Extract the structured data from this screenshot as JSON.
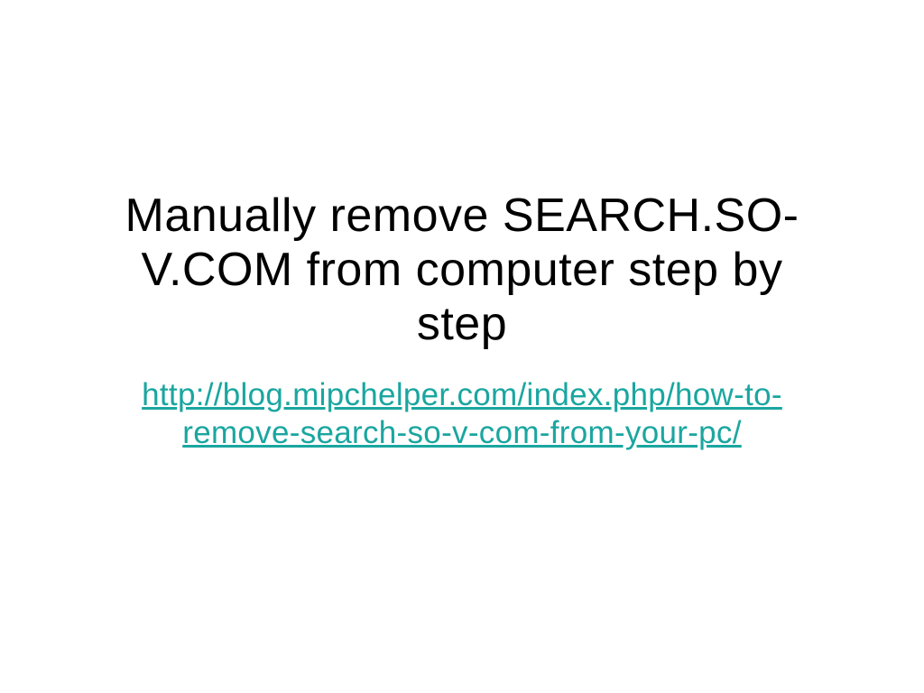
{
  "slide": {
    "title": "Manually remove SEARCH.SO-V.COM from computer step by step",
    "link_text": "http://blog.mipchelper.com/index.php/how-to-remove-search-so-v-com-from-your-pc/"
  }
}
